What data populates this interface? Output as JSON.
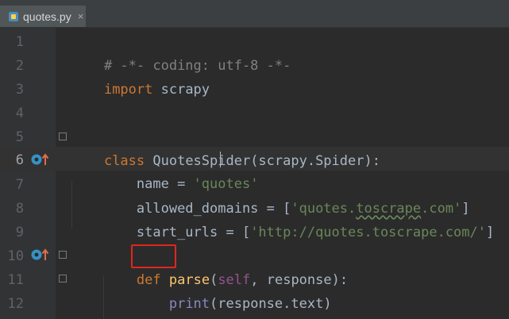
{
  "tab": {
    "file_name": "quotes.py",
    "close": "×"
  },
  "gutter": {
    "line_numbers": [
      "1",
      "2",
      "3",
      "4",
      "5",
      "6",
      "7",
      "8",
      "9",
      "10",
      "11",
      "12"
    ],
    "active_line": "6"
  },
  "code": {
    "line1": {
      "comment": "# -*- coding: utf-8 -*-"
    },
    "line2": {
      "keyword": "import",
      "module": " scrapy"
    },
    "line5": {
      "keyword": "class",
      "rest": " QuotesSpider(scrapy.Spider):"
    },
    "line6": {
      "name": "    name = ",
      "value": "'quotes'"
    },
    "line7": {
      "name": "    allowed_domains = [",
      "value_pre": "'quotes.",
      "value_squiggle": "toscrape",
      "value_post": ".com'",
      "close": "]"
    },
    "line8": {
      "name": "    start_urls = [",
      "value": "'http://quotes.toscrape.com/'",
      "close": "]"
    },
    "line10": {
      "indent": "    ",
      "keyword": "def",
      "space": " ",
      "fn": "parse",
      "open": "(",
      "self": "self",
      "rest": ", response):"
    },
    "line11": {
      "indent": "        ",
      "fn": "print",
      "rest": "(response.text)"
    }
  },
  "colors": {
    "keyword": "#cc7832",
    "comment": "#808080",
    "string": "#6a8759",
    "function": "#ffc66d",
    "self": "#94558d",
    "highlight_box": "#e1261d"
  },
  "icons": {
    "override": "method-override-icon",
    "fold": "fold-marker-icon",
    "file": "python-file-icon"
  }
}
